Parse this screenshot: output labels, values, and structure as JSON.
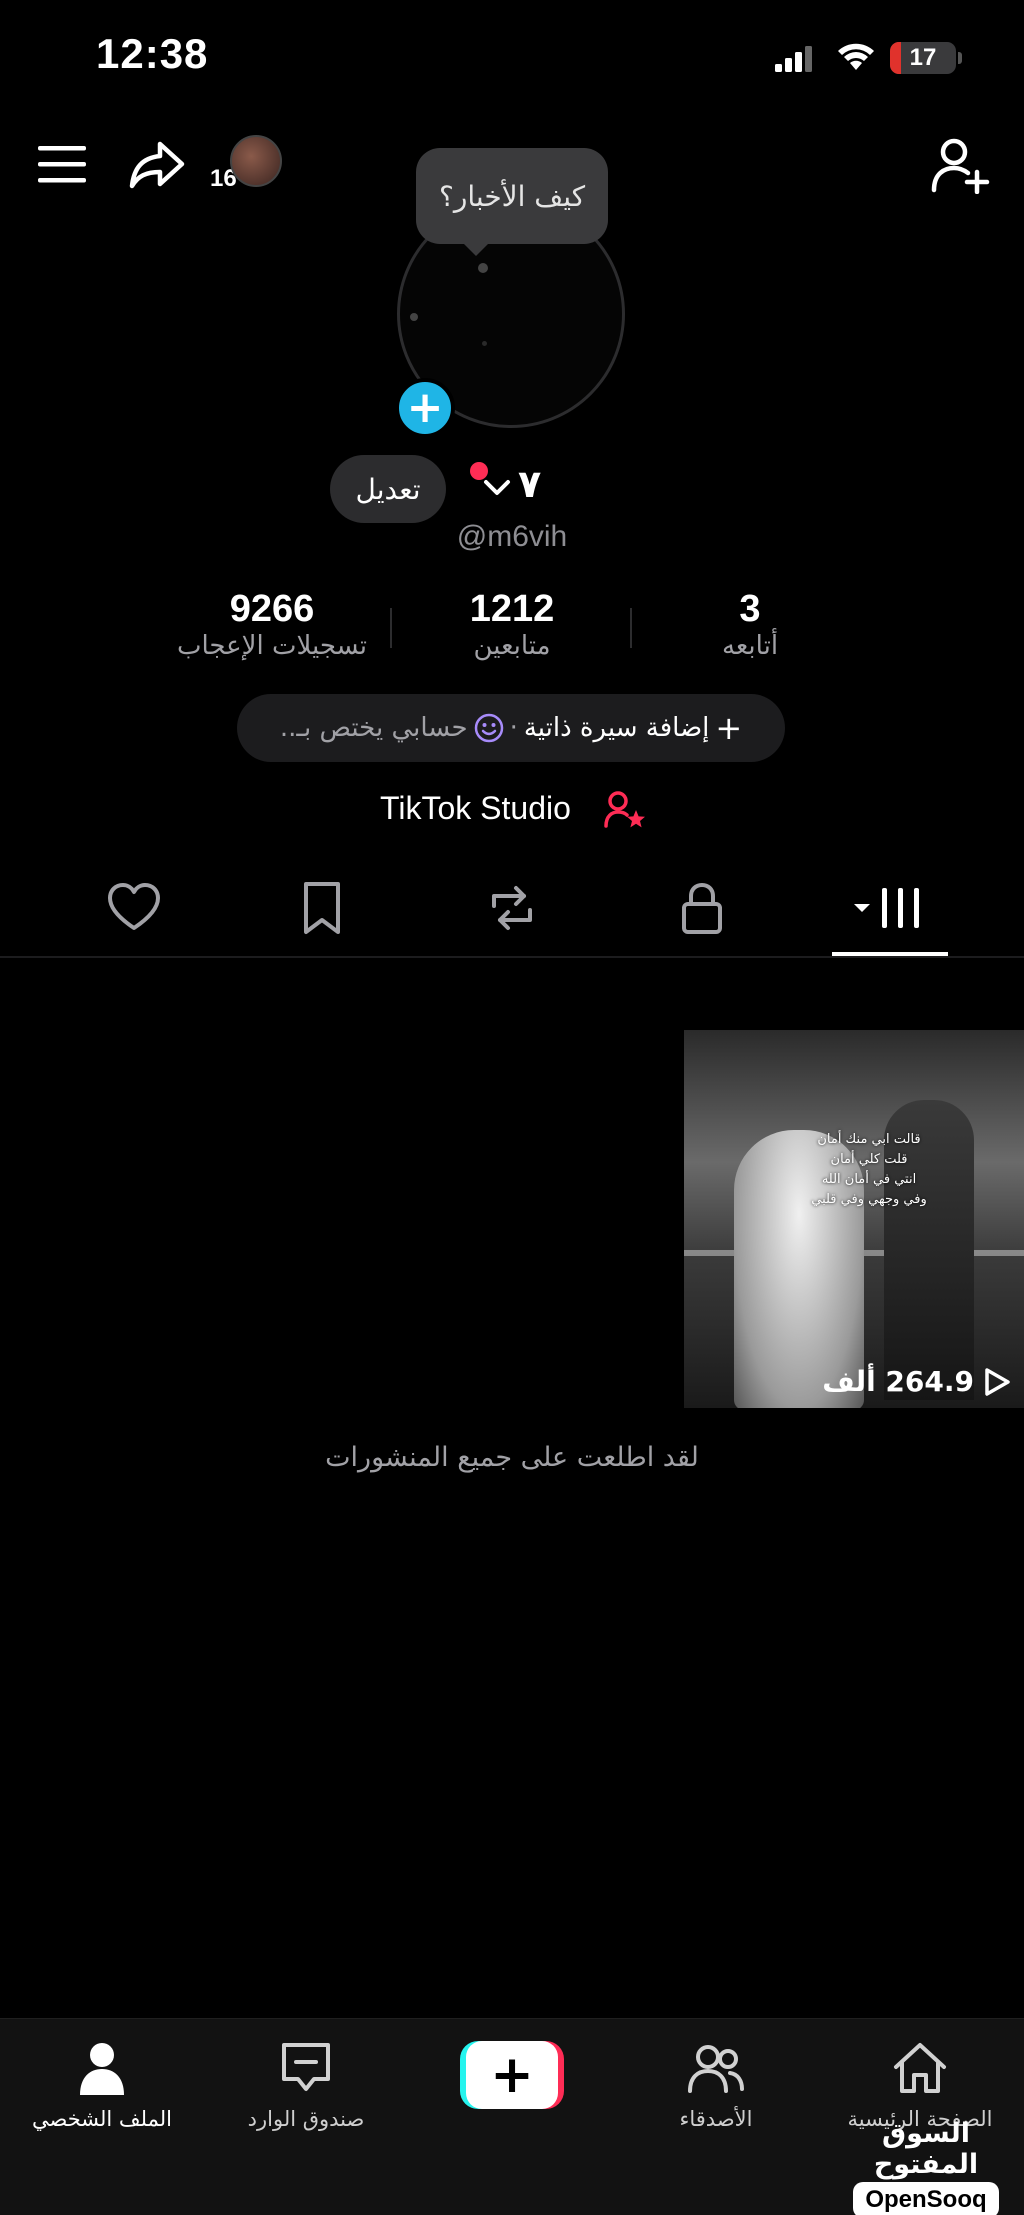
{
  "status_bar": {
    "time": "12:38",
    "battery_level": "17",
    "battery_percent": 17,
    "battery_color": "#e0322c"
  },
  "header": {
    "menu_icon": "hamburger-menu-icon",
    "share_icon": "share-arrow-icon",
    "story_count": "16",
    "add_friend_icon": "add-user-icon"
  },
  "profile": {
    "note_bubble": "كيف الأخبار؟",
    "edit_label": "تعديل",
    "display_name": "٧",
    "username": "@m6vih"
  },
  "stats": [
    {
      "value": "3",
      "label": "أتابعه"
    },
    {
      "value": "1212",
      "label": "متابعين"
    },
    {
      "value": "9266",
      "label": "تسجيلات الإعجاب"
    }
  ],
  "bio": {
    "add_label": "إضافة سيرة ذاتية",
    "separator": "·",
    "preview": "حسابي يختص بـ..",
    "emoji_icon": "smiley-face-icon"
  },
  "studio": {
    "label": "TikTok Studio",
    "icon": "user-star-icon",
    "icon_color": "#fe2c55"
  },
  "tabs": [
    {
      "name": "videos-grid",
      "icon": "grid-bars-icon",
      "active": true
    },
    {
      "name": "private",
      "icon": "lock-icon"
    },
    {
      "name": "reposts",
      "icon": "repost-icon"
    },
    {
      "name": "favorites",
      "icon": "bookmark-icon"
    },
    {
      "name": "liked",
      "icon": "heart-icon"
    }
  ],
  "videos": [
    {
      "views": "264.9 ألف",
      "caption_lines": [
        "قالت ابي منك أمان",
        "قلت كلي أمان",
        "انتي في أمان الله",
        "وفي وجهي وفي قلبي"
      ]
    }
  ],
  "end_message": "لقد اطلعت على جميع المنشورات",
  "bottom_nav": [
    {
      "label": "الصفحة الرئيسية",
      "icon": "home-icon"
    },
    {
      "label": "الأصدقاء",
      "icon": "friends-icon"
    },
    {
      "label": "",
      "icon": "create-plus-icon"
    },
    {
      "label": "صندوق الوارد",
      "icon": "inbox-icon"
    },
    {
      "label": "الملف الشخصي",
      "icon": "profile-icon",
      "active": true
    }
  ],
  "watermark": {
    "arabic": "السوق المفتوح",
    "english": "OpenSooq"
  },
  "colors": {
    "accent_blue": "#1fb5e6",
    "accent_red": "#fe2c55",
    "accent_cyan": "#25f4ee"
  }
}
